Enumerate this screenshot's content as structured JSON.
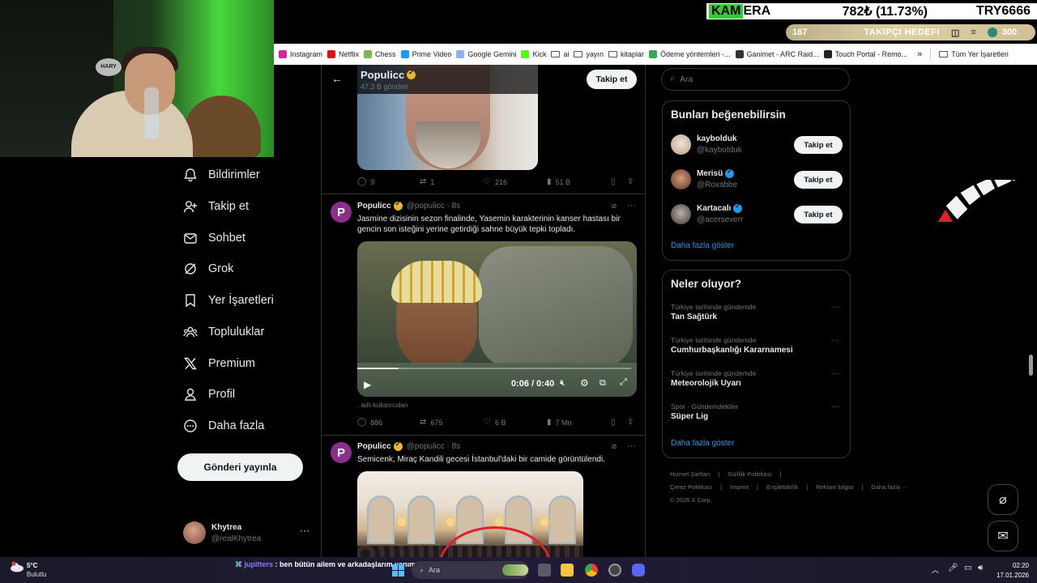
{
  "stream": {
    "ticker_name_highlight": "KAM",
    "ticker_name_rest": "ERA",
    "ticker_change": "782₺ (11.73%)",
    "ticker_pair": "TRY6666",
    "goal_count": "167",
    "goal_label": "TAKIPÇI HEDEFI",
    "goal_target": "300",
    "webcam_mic_brand": "HARY"
  },
  "bookmarks": {
    "items": [
      {
        "label": "Instagram",
        "icon": "instagram-icon",
        "color": "#d6249f"
      },
      {
        "label": "Netflix",
        "icon": "netflix-icon",
        "color": "#e50914"
      },
      {
        "label": "Chess",
        "icon": "chess-icon",
        "color": "#81b64c"
      },
      {
        "label": "Prime Video",
        "icon": "prime-video-icon",
        "color": "#1a98ff"
      },
      {
        "label": "Google Gemini",
        "icon": "gemini-icon",
        "color": "#8ab4f8"
      },
      {
        "label": "Kick",
        "icon": "kick-icon",
        "color": "#53fc18"
      },
      {
        "label": "ai",
        "icon": "folder-icon"
      },
      {
        "label": "yayın",
        "icon": "folder-icon"
      },
      {
        "label": "kitaplar",
        "icon": "folder-icon"
      },
      {
        "label": "Ödeme yöntemleri -...",
        "icon": "drive-icon",
        "color": "#34a853"
      },
      {
        "label": "Ganimet - ARC Raid...",
        "icon": "arc-raiders-icon",
        "color": "#333333"
      },
      {
        "label": "Touch Portal - Remo...",
        "icon": "touch-portal-icon",
        "color": "#222222"
      }
    ],
    "more": "»",
    "all_bookmarks": "Tüm Yer İşaretleri"
  },
  "nav": {
    "items": [
      {
        "label": "Bildirimler",
        "icon": "bell-icon"
      },
      {
        "label": "Takip et",
        "icon": "person-add-icon"
      },
      {
        "label": "Sohbet",
        "icon": "mail-icon"
      },
      {
        "label": "Grok",
        "icon": "grok-icon"
      },
      {
        "label": "Yer İşaretleri",
        "icon": "bookmark-icon"
      },
      {
        "label": "Topluluklar",
        "icon": "communities-icon"
      },
      {
        "label": "Premium",
        "icon": "x-logo-icon"
      },
      {
        "label": "Profil",
        "icon": "profile-icon"
      },
      {
        "label": "Daha fazla",
        "icon": "more-circle-icon"
      }
    ],
    "post_button": "Gönderi yayınla",
    "account": {
      "name": "Khytrea",
      "handle": "@realKhytrea",
      "more": "···"
    }
  },
  "timeline": {
    "header": {
      "back": "←",
      "title": "Populicc",
      "subtitle": "47,3 B gönderi",
      "follow": "Takip et"
    },
    "tweets": [
      {
        "actions": {
          "replies": "9",
          "reposts": "1",
          "likes": "216",
          "views": "51 B"
        }
      },
      {
        "avatar_letter": "P",
        "name": "Populicc",
        "handle": "@populicc",
        "time": "· 8s",
        "text": "Jasmine dizisinin sezon finalinde, Yasemin karakterinin kanser hastası bir gencin son isteğini yerine getirdiği sahne büyük tepki topladı.",
        "video": {
          "time": "0:06 / 0:40",
          "progress": 0.15
        },
        "attribution": ". adlı kullanıcıdan",
        "actions": {
          "replies": "886",
          "reposts": "675",
          "likes": "6 B",
          "views": "7 Mn"
        }
      },
      {
        "avatar_letter": "P",
        "name": "Populicc",
        "handle": "@populicc",
        "time": "· 8s",
        "text": "Semicenk, Miraç Kandili gecesi İstanbul'daki bir camide görüntülendi."
      }
    ]
  },
  "sidebar": {
    "search_placeholder": "Ara",
    "suggestions": {
      "title": "Bunları beğenebilirsin",
      "items": [
        {
          "name": "kaybolduk",
          "handle": "@kayboIduk",
          "verified": false,
          "follow": "Takip et"
        },
        {
          "name": "Merisü",
          "handle": "@Roxabbe",
          "verified": true,
          "follow": "Takip et"
        },
        {
          "name": "Kartacalı",
          "handle": "@acerseverr",
          "verified": true,
          "follow": "Takip et"
        }
      ],
      "show_more": "Daha fazla göster"
    },
    "trends": {
      "title": "Neler oluyor?",
      "items": [
        {
          "context": "Türkiye tarihinde gündemde",
          "name": "Tan Sağtürk"
        },
        {
          "context": "Türkiye tarihinde gündemde",
          "name": "Cumhurbaşkanlığı Kararnamesi"
        },
        {
          "context": "Türkiye tarihinde gündemde",
          "name": "Meteorolojik Uyarı"
        },
        {
          "context": "Spor · Gündemdekiler",
          "name": "Süper Lig"
        }
      ],
      "show_more": "Daha fazla göster"
    },
    "footer": {
      "links": [
        "Hizmet Şartları",
        "|",
        "Gizlilik Politikası",
        "|",
        "Çerez Politikası",
        "|",
        "Imprint",
        "|",
        "Erişilebilirlik",
        "|",
        "Reklam bilgisi",
        "|",
        "Daha fazla ···"
      ],
      "copyright": "© 2026 X Corp."
    }
  },
  "taskbar": {
    "weather_temp": "5°C",
    "weather_desc": "Bulutlu",
    "chat_user": "jupitters",
    "chat_text": ": ben bütün ailem ve arkadaşlarım yanıma gelsin isterdim",
    "search_placeholder": "Ara",
    "time": "02:20",
    "date": "17.01.2026"
  },
  "colors": {
    "accent": "#1d9bf0",
    "verified_gold": "#e8b829",
    "ticker_green": "#33cc33"
  }
}
